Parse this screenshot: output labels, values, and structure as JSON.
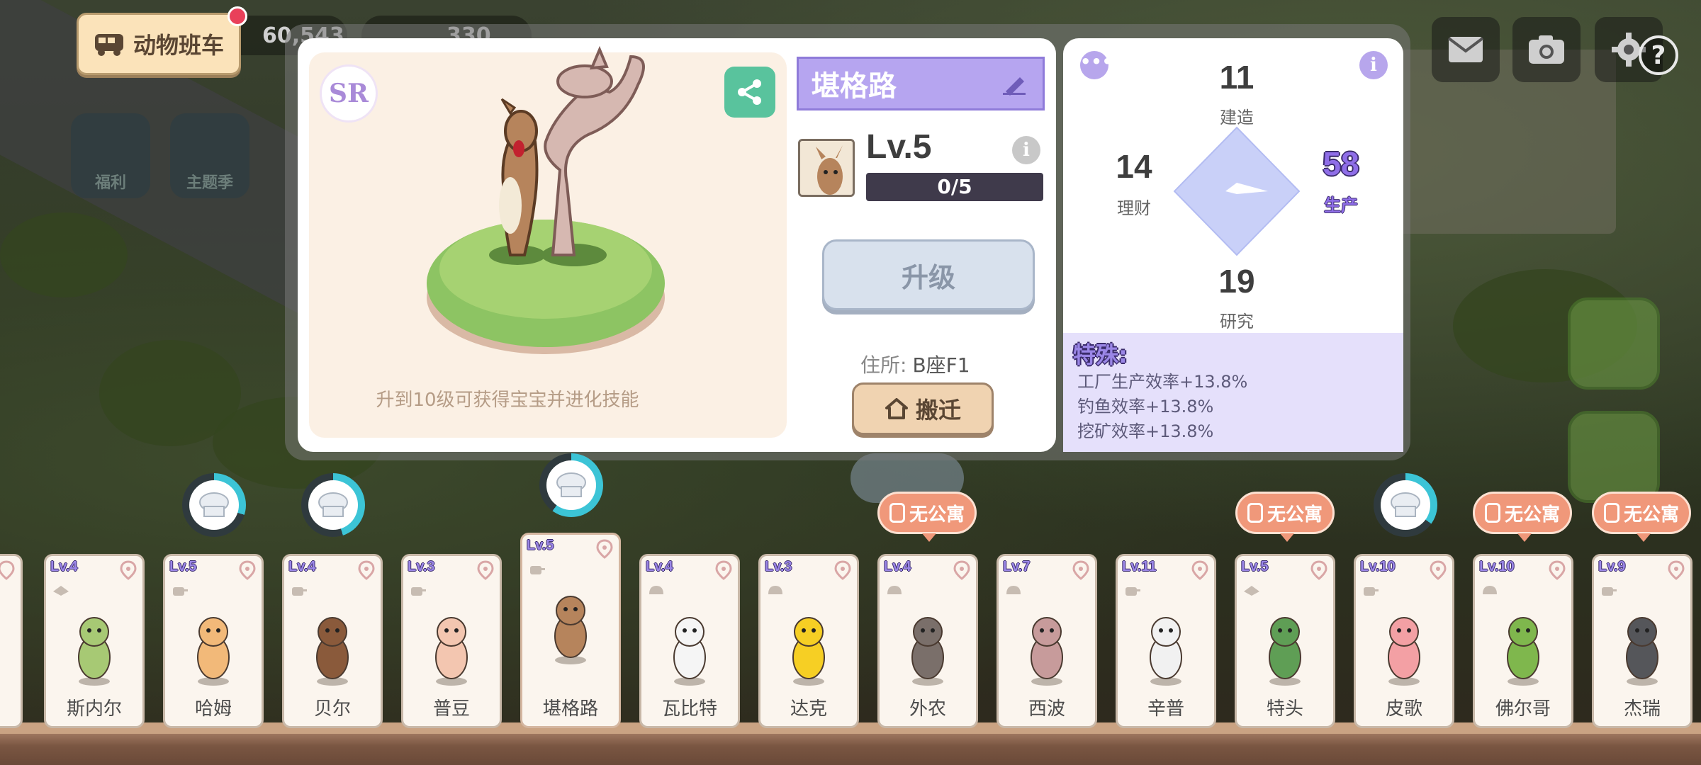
{
  "top_bar": {
    "bus_button_label": "动物班车",
    "resource_1": "60,543",
    "resource_2": "330",
    "left_icons": [
      "福利",
      "主题季"
    ]
  },
  "animal_detail": {
    "rarity": "SR",
    "name": "堪格路",
    "level": "Lv.5",
    "level_progress_text": "0/5",
    "level_progress_fraction": 0.0,
    "upgrade_label": "升级",
    "address_label": "住所:",
    "address_value": "B座F1",
    "move_label": "搬迁",
    "evolve_tip": "升到10级可获得宝宝并进化技能"
  },
  "stats": {
    "build": {
      "value": "11",
      "label": "建造"
    },
    "finance": {
      "value": "14",
      "label": "理财"
    },
    "production": {
      "value": "58",
      "label": "生产"
    },
    "research": {
      "value": "19",
      "label": "研究"
    },
    "special_title": "特殊:",
    "special_lines": [
      "工厂生产效率+13.8%",
      "钓鱼效率+13.8%",
      "挖矿效率+13.8%"
    ]
  },
  "animal_cards": [
    {
      "level": "Lv.4",
      "name": "斯内尔",
      "job": "hat",
      "color": "#a7c974"
    },
    {
      "level": "Lv.5",
      "name": "哈姆",
      "job": "pot",
      "color": "#f2b979"
    },
    {
      "level": "Lv.4",
      "name": "贝尔",
      "job": "pot",
      "color": "#8a5a3b"
    },
    {
      "level": "Lv.3",
      "name": "普豆",
      "job": "pot",
      "color": "#f3c6b0"
    },
    {
      "level": "Lv.5",
      "name": "堪格路",
      "job": "pot",
      "color": "#b6845c"
    },
    {
      "level": "Lv.4",
      "name": "瓦比特",
      "job": "helmet",
      "color": "#f5f5f5"
    },
    {
      "level": "Lv.3",
      "name": "达克",
      "job": "helmet",
      "color": "#f6cf24"
    },
    {
      "level": "Lv.4",
      "name": "外农",
      "job": "helmet",
      "color": "#7a6f6a"
    },
    {
      "level": "Lv.7",
      "name": "西波",
      "job": "helmet",
      "color": "#c79b9b"
    },
    {
      "level": "Lv.11",
      "name": "辛普",
      "job": "pot",
      "color": "#f1f1f1"
    },
    {
      "level": "Lv.5",
      "name": "特头",
      "job": "hat",
      "color": "#5f9e55"
    },
    {
      "level": "Lv.10",
      "name": "皮歌",
      "job": "pot",
      "color": "#f3a0a4"
    },
    {
      "level": "Lv.10",
      "name": "佛尔哥",
      "job": "helmet",
      "color": "#7fb74d"
    },
    {
      "level": "Lv.9",
      "name": "杰瑞",
      "job": "pot",
      "color": "#55565a"
    }
  ],
  "no_apartment_label": "无公寓",
  "chef_progress": [
    0.3,
    0.45,
    0.6,
    0.35
  ],
  "colors": {
    "accent_purple": "#8f6ee8",
    "share_green": "#59c39d",
    "badge_orange": "#f0987a"
  }
}
